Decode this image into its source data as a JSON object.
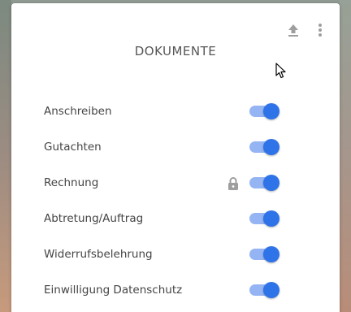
{
  "card": {
    "title": "DOKUMENTE",
    "toolbar": {
      "upload_icon": "upload-icon",
      "more_icon": "more-vertical-icon"
    }
  },
  "documents": [
    {
      "label": "Anschreiben",
      "enabled": true,
      "locked": false
    },
    {
      "label": "Gutachten",
      "enabled": true,
      "locked": false
    },
    {
      "label": "Rechnung",
      "enabled": true,
      "locked": true
    },
    {
      "label": "Abtretung/Auftrag",
      "enabled": true,
      "locked": false
    },
    {
      "label": "Widerrufsbelehrung",
      "enabled": true,
      "locked": false
    },
    {
      "label": "Einwilligung Datenschutz",
      "enabled": true,
      "locked": false
    }
  ],
  "colors": {
    "toggle_track_on": "#94b4f4",
    "toggle_thumb_on": "#2f73e8",
    "title": "#555555",
    "icon_gray": "#9e9e9e"
  }
}
